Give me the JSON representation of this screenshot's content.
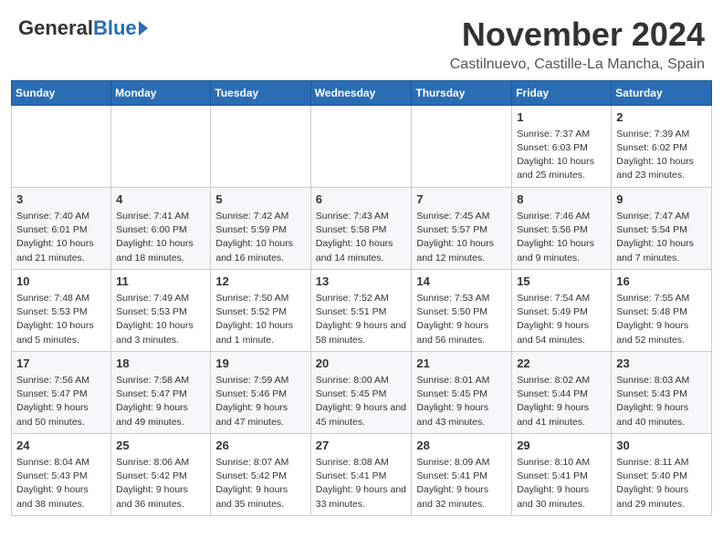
{
  "header": {
    "logo_general": "General",
    "logo_blue": "Blue",
    "month": "November 2024",
    "location": "Castilnuevo, Castille-La Mancha, Spain"
  },
  "days_of_week": [
    "Sunday",
    "Monday",
    "Tuesday",
    "Wednesday",
    "Thursday",
    "Friday",
    "Saturday"
  ],
  "weeks": [
    [
      {
        "day": "",
        "info": ""
      },
      {
        "day": "",
        "info": ""
      },
      {
        "day": "",
        "info": ""
      },
      {
        "day": "",
        "info": ""
      },
      {
        "day": "",
        "info": ""
      },
      {
        "day": "1",
        "info": "Sunrise: 7:37 AM\nSunset: 6:03 PM\nDaylight: 10 hours and 25 minutes."
      },
      {
        "day": "2",
        "info": "Sunrise: 7:39 AM\nSunset: 6:02 PM\nDaylight: 10 hours and 23 minutes."
      }
    ],
    [
      {
        "day": "3",
        "info": "Sunrise: 7:40 AM\nSunset: 6:01 PM\nDaylight: 10 hours and 21 minutes."
      },
      {
        "day": "4",
        "info": "Sunrise: 7:41 AM\nSunset: 6:00 PM\nDaylight: 10 hours and 18 minutes."
      },
      {
        "day": "5",
        "info": "Sunrise: 7:42 AM\nSunset: 5:59 PM\nDaylight: 10 hours and 16 minutes."
      },
      {
        "day": "6",
        "info": "Sunrise: 7:43 AM\nSunset: 5:58 PM\nDaylight: 10 hours and 14 minutes."
      },
      {
        "day": "7",
        "info": "Sunrise: 7:45 AM\nSunset: 5:57 PM\nDaylight: 10 hours and 12 minutes."
      },
      {
        "day": "8",
        "info": "Sunrise: 7:46 AM\nSunset: 5:56 PM\nDaylight: 10 hours and 9 minutes."
      },
      {
        "day": "9",
        "info": "Sunrise: 7:47 AM\nSunset: 5:54 PM\nDaylight: 10 hours and 7 minutes."
      }
    ],
    [
      {
        "day": "10",
        "info": "Sunrise: 7:48 AM\nSunset: 5:53 PM\nDaylight: 10 hours and 5 minutes."
      },
      {
        "day": "11",
        "info": "Sunrise: 7:49 AM\nSunset: 5:53 PM\nDaylight: 10 hours and 3 minutes."
      },
      {
        "day": "12",
        "info": "Sunrise: 7:50 AM\nSunset: 5:52 PM\nDaylight: 10 hours and 1 minute."
      },
      {
        "day": "13",
        "info": "Sunrise: 7:52 AM\nSunset: 5:51 PM\nDaylight: 9 hours and 58 minutes."
      },
      {
        "day": "14",
        "info": "Sunrise: 7:53 AM\nSunset: 5:50 PM\nDaylight: 9 hours and 56 minutes."
      },
      {
        "day": "15",
        "info": "Sunrise: 7:54 AM\nSunset: 5:49 PM\nDaylight: 9 hours and 54 minutes."
      },
      {
        "day": "16",
        "info": "Sunrise: 7:55 AM\nSunset: 5:48 PM\nDaylight: 9 hours and 52 minutes."
      }
    ],
    [
      {
        "day": "17",
        "info": "Sunrise: 7:56 AM\nSunset: 5:47 PM\nDaylight: 9 hours and 50 minutes."
      },
      {
        "day": "18",
        "info": "Sunrise: 7:58 AM\nSunset: 5:47 PM\nDaylight: 9 hours and 49 minutes."
      },
      {
        "day": "19",
        "info": "Sunrise: 7:59 AM\nSunset: 5:46 PM\nDaylight: 9 hours and 47 minutes."
      },
      {
        "day": "20",
        "info": "Sunrise: 8:00 AM\nSunset: 5:45 PM\nDaylight: 9 hours and 45 minutes."
      },
      {
        "day": "21",
        "info": "Sunrise: 8:01 AM\nSunset: 5:45 PM\nDaylight: 9 hours and 43 minutes."
      },
      {
        "day": "22",
        "info": "Sunrise: 8:02 AM\nSunset: 5:44 PM\nDaylight: 9 hours and 41 minutes."
      },
      {
        "day": "23",
        "info": "Sunrise: 8:03 AM\nSunset: 5:43 PM\nDaylight: 9 hours and 40 minutes."
      }
    ],
    [
      {
        "day": "24",
        "info": "Sunrise: 8:04 AM\nSunset: 5:43 PM\nDaylight: 9 hours and 38 minutes."
      },
      {
        "day": "25",
        "info": "Sunrise: 8:06 AM\nSunset: 5:42 PM\nDaylight: 9 hours and 36 minutes."
      },
      {
        "day": "26",
        "info": "Sunrise: 8:07 AM\nSunset: 5:42 PM\nDaylight: 9 hours and 35 minutes."
      },
      {
        "day": "27",
        "info": "Sunrise: 8:08 AM\nSunset: 5:41 PM\nDaylight: 9 hours and 33 minutes."
      },
      {
        "day": "28",
        "info": "Sunrise: 8:09 AM\nSunset: 5:41 PM\nDaylight: 9 hours and 32 minutes."
      },
      {
        "day": "29",
        "info": "Sunrise: 8:10 AM\nSunset: 5:41 PM\nDaylight: 9 hours and 30 minutes."
      },
      {
        "day": "30",
        "info": "Sunrise: 8:11 AM\nSunset: 5:40 PM\nDaylight: 9 hours and 29 minutes."
      }
    ]
  ]
}
